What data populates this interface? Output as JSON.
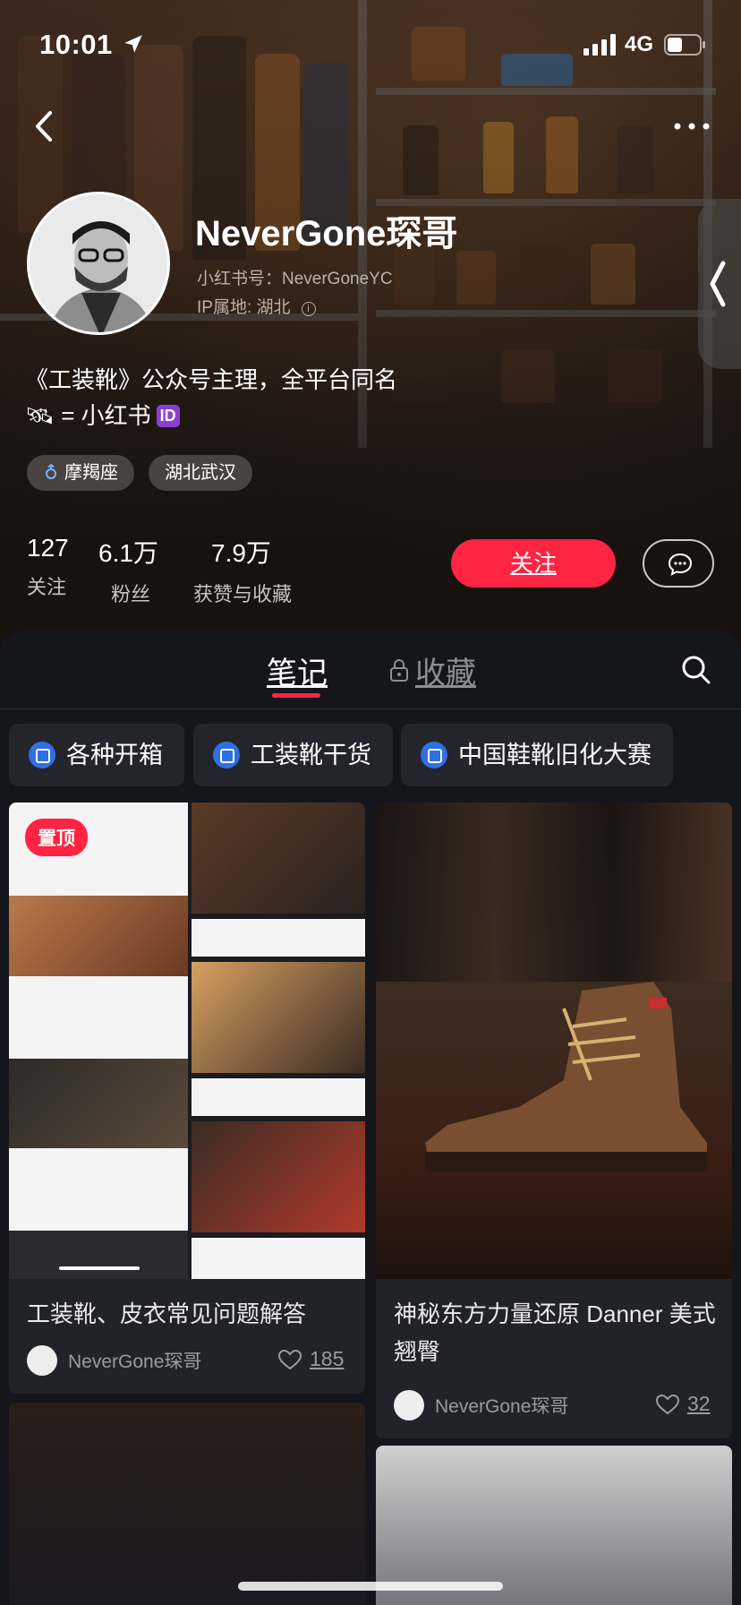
{
  "status_bar": {
    "time": "10:01",
    "network": "4G"
  },
  "profile": {
    "name": "NeverGone琛哥",
    "redbook_id": "小红书号：NeverGoneYC",
    "ip_location": "IP属地: 湖北",
    "bio_line1": "《工装靴》公众号主理，全平台同名",
    "bio_line2_text": "🛰 = 小红书",
    "bio_badge": "ID",
    "tags": [
      "摩羯座",
      "湖北武汉"
    ]
  },
  "stats": [
    {
      "value": "127",
      "label": "关注"
    },
    {
      "value": "6.1万",
      "label": "粉丝"
    },
    {
      "value": "7.9万",
      "label": "获赞与收藏"
    }
  ],
  "actions": {
    "follow": "关注"
  },
  "tabs": {
    "notes": "笔记",
    "favorites": "收藏"
  },
  "collections": [
    "各种开箱",
    "工装靴干货",
    "中国鞋靴旧化大赛"
  ],
  "notes": [
    {
      "pin": "置顶",
      "title": "工装靴、皮衣常见问题解答",
      "author": "NeverGone琛哥",
      "likes": "185"
    },
    {
      "title": "神秘东方力量还原 Danner 美式翘臀",
      "author": "NeverGone琛哥",
      "likes": "32"
    }
  ],
  "colors": {
    "accent": "#ff2442",
    "panel": "#15151c",
    "card": "#22222a"
  }
}
